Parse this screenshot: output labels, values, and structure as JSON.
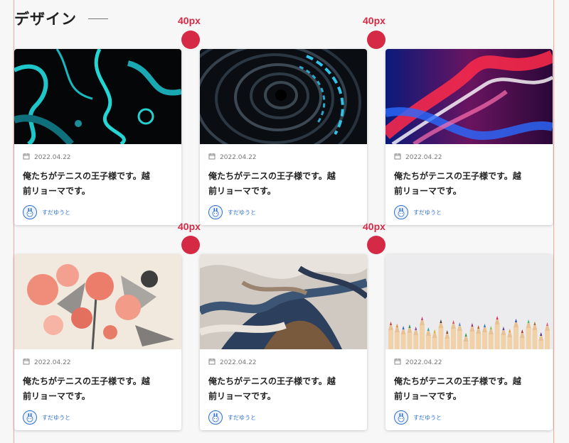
{
  "section": {
    "title": "デザイン"
  },
  "spacing_label": "40px",
  "cards": [
    {
      "date": "2022.04.22",
      "title": "俺たちがテニスの王子様です。越前リョーマです。",
      "author": "すだゆうと",
      "image": "abstract-cyan-fluid"
    },
    {
      "date": "2022.04.22",
      "title": "俺たちがテニスの王子様です。越前リョーマです。",
      "author": "すだゆうと",
      "image": "neon-tunnel"
    },
    {
      "date": "2022.04.22",
      "title": "俺たちがテニスの王子様です。越前リョーマです。",
      "author": "すだゆうと",
      "image": "red-blue-light-streaks"
    },
    {
      "date": "2022.04.22",
      "title": "俺たちがテニスの王子様です。越前リョーマです。",
      "author": "すだゆうと",
      "image": "flower-bouquet-illustration"
    },
    {
      "date": "2022.04.22",
      "title": "俺たちがテニスの王子様です。越前リョーマです。",
      "author": "すだゆうと",
      "image": "swirling-paint"
    },
    {
      "date": "2022.04.22",
      "title": "俺たちがテニスの王子様です。越前リョーマです。",
      "author": "すだゆうと",
      "image": "colored-pencils"
    }
  ],
  "colors": {
    "accent": "#d42a45",
    "author_link": "#2d6fd6",
    "guide": "#f3a99d"
  }
}
